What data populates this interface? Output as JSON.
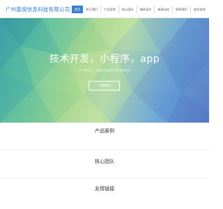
{
  "header": {
    "logo": "广州盈锐信息科技有限公司",
    "nav": [
      {
        "label": "首页",
        "active": true
      },
      {
        "label": "关于我们",
        "active": false
      },
      {
        "label": "产品案例",
        "active": false
      },
      {
        "label": "核心团队",
        "active": false
      },
      {
        "label": "城市英才",
        "active": false
      },
      {
        "label": "新闻动态",
        "active": false
      },
      {
        "label": "联系我们",
        "active": false
      },
      {
        "label": "留言咨询",
        "active": false
      }
    ]
  },
  "hero": {
    "title": "技术开发，小程序，app",
    "subtitle": "2016年至今，持续为企业提供设计技术服务",
    "button": "了解更多"
  },
  "sections": [
    {
      "title": "产品案例"
    },
    {
      "title": "核心团队"
    },
    {
      "title": "友情链接"
    }
  ],
  "colors": {
    "accent": "#3a7fd0",
    "logo": "#2d7dd2"
  }
}
